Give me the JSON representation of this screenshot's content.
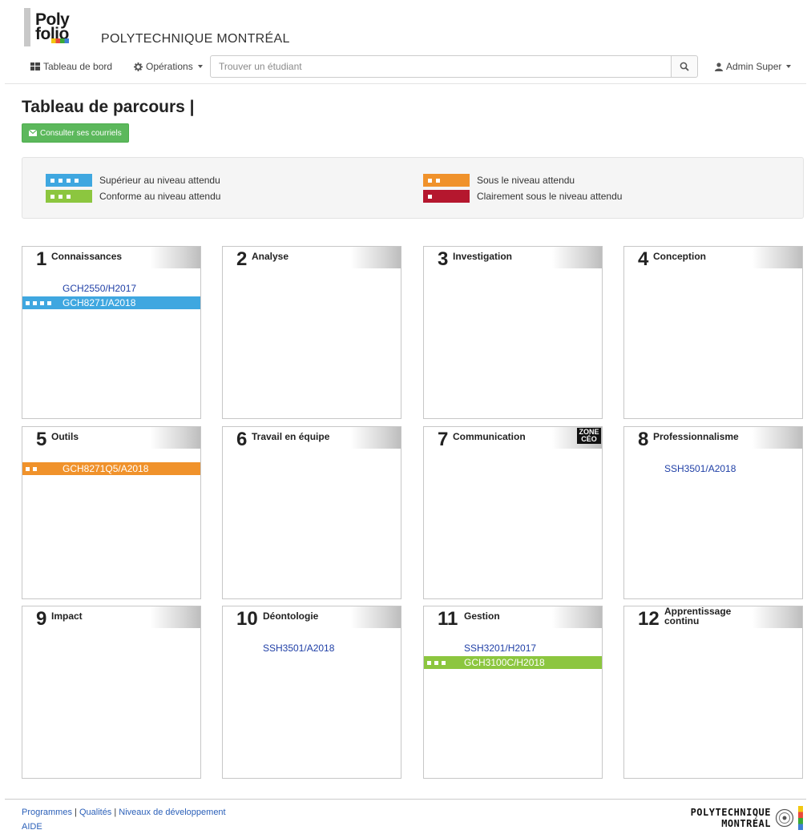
{
  "brand": {
    "logo_line1": "Poly",
    "logo_line2": "folio",
    "name": "POLYTECHNIQUE MONTRÉAL"
  },
  "nav": {
    "dashboard": "Tableau de bord",
    "operations": "Opérations",
    "search_placeholder": "Trouver un étudiant",
    "user": "Admin Super"
  },
  "page": {
    "title": "Tableau de parcours |",
    "email_button": "Consulter ses courriels"
  },
  "colors": {
    "lvl4": "#3fa7e0",
    "lvl3": "#8cc63f",
    "lvl2": "#f0922b",
    "lvl1": "#b5172e"
  },
  "legend": [
    {
      "level": 4,
      "label": "Supérieur au niveau attendu"
    },
    {
      "level": 3,
      "label": "Conforme au niveau attendu"
    },
    {
      "level": 2,
      "label": "Sous le niveau attendu"
    },
    {
      "level": 1,
      "label": "Clairement sous le niveau attendu"
    }
  ],
  "qualities": [
    {
      "num": "1",
      "title": "Connaissances",
      "courses": [
        {
          "code": "GCH2550/H2017",
          "level": 0
        },
        {
          "code": "GCH8271/A2018",
          "level": 4
        }
      ]
    },
    {
      "num": "2",
      "title": "Analyse",
      "courses": []
    },
    {
      "num": "3",
      "title": "Investigation",
      "courses": []
    },
    {
      "num": "4",
      "title": "Conception",
      "courses": []
    },
    {
      "num": "5",
      "title": "Outils",
      "courses": [
        {
          "code": "GCH8271Q5/A2018",
          "level": 2
        }
      ]
    },
    {
      "num": "6",
      "title": "Travail en équipe",
      "courses": []
    },
    {
      "num": "7",
      "title": "Communication",
      "badge": "ZONE CÉO",
      "courses": []
    },
    {
      "num": "8",
      "title": "Professionnalisme",
      "courses": [
        {
          "code": "SSH3501/A2018",
          "level": 0
        }
      ]
    },
    {
      "num": "9",
      "title": "Impact",
      "courses": []
    },
    {
      "num": "10",
      "title": "Déontologie",
      "courses": [
        {
          "code": "SSH3501/A2018",
          "level": 0
        }
      ]
    },
    {
      "num": "11",
      "title": "Gestion",
      "courses": [
        {
          "code": "SSH3201/H2017",
          "level": 0
        },
        {
          "code": "GCH3100C/H2018",
          "level": 3
        }
      ]
    },
    {
      "num": "12",
      "title": "Apprentissage continu",
      "courses": []
    }
  ],
  "footer": {
    "links": [
      "Programmes",
      "Qualités",
      "Niveaux de développement"
    ],
    "help": "AIDE",
    "logo_line1": "POLYTECHNIQUE",
    "logo_line2": "MONTRÉAL"
  }
}
